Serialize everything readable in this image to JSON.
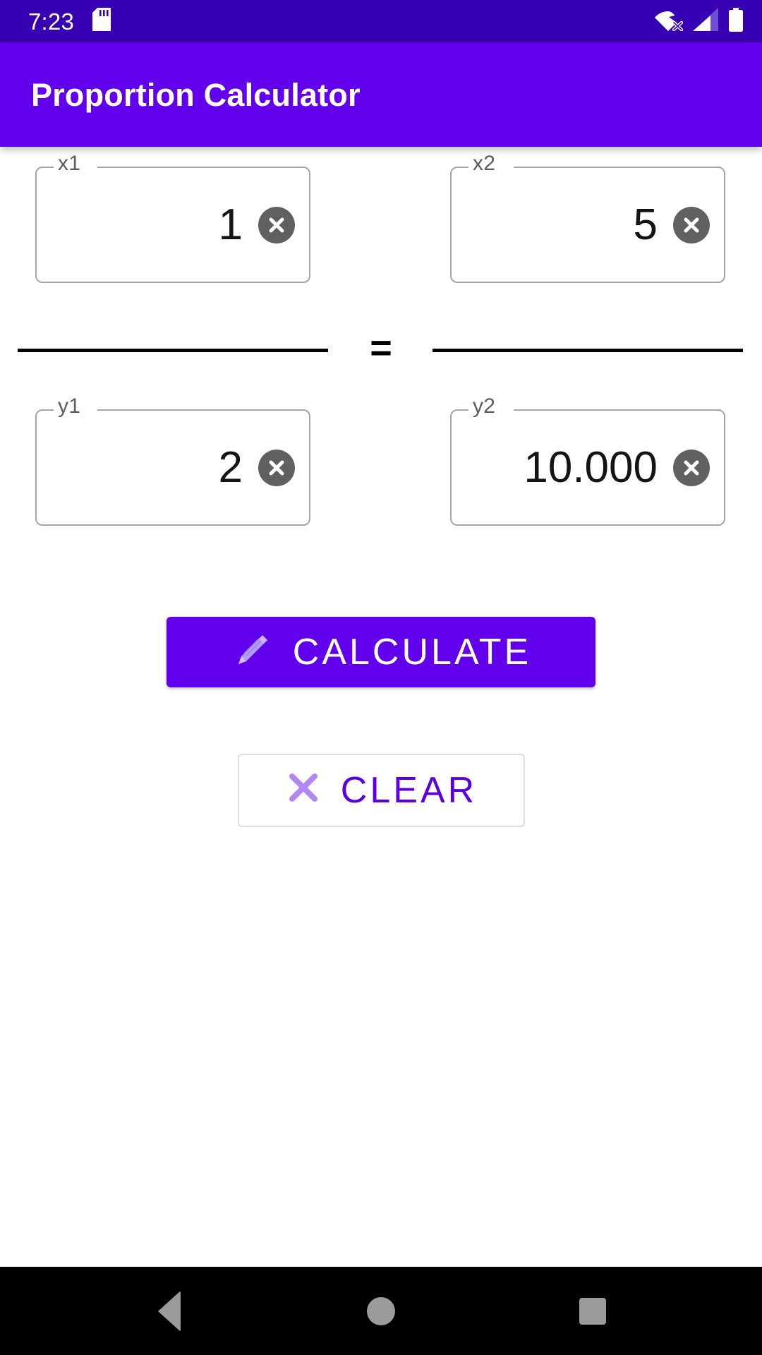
{
  "status_bar": {
    "time": "7:23",
    "icons": [
      {
        "name": "sd-card-icon"
      },
      {
        "name": "wifi-off-icon"
      },
      {
        "name": "cellular-signal-icon"
      },
      {
        "name": "battery-full-icon"
      }
    ],
    "background_color": "#3700B3"
  },
  "app_bar": {
    "title": "Proportion Calculator",
    "background_color": "#6200EE",
    "title_color": "#FFFFFF"
  },
  "form": {
    "fields": [
      {
        "id": "x1",
        "label": "x1",
        "value": "1",
        "clear_icon": "clear-circle-icon"
      },
      {
        "id": "x2",
        "label": "x2",
        "value": "5",
        "clear_icon": "clear-circle-icon"
      },
      {
        "id": "y1",
        "label": "y1",
        "value": "2",
        "clear_icon": "clear-circle-icon"
      },
      {
        "id": "y2",
        "label": "y2",
        "value": "10.000",
        "clear_icon": "clear-circle-icon"
      }
    ],
    "equals_sign": "=",
    "fraction_bar_color": "#000000",
    "outline_color": "#A6A6A6",
    "clear_button_color": "#606060"
  },
  "actions": {
    "calculate": {
      "label": "CALCULATE",
      "icon": "pencil-icon",
      "background_color": "#6200EE",
      "text_color": "#FFFFFF"
    },
    "clear": {
      "label": "CLEAR",
      "icon": "cross-icon",
      "background_color": "#FFFFFF",
      "text_color": "#5C00E0",
      "icon_color": "#B388F5"
    }
  },
  "nav_bar": {
    "buttons": [
      {
        "name": "back-button"
      },
      {
        "name": "home-button"
      },
      {
        "name": "recents-button"
      }
    ],
    "background_color": "#000000"
  }
}
